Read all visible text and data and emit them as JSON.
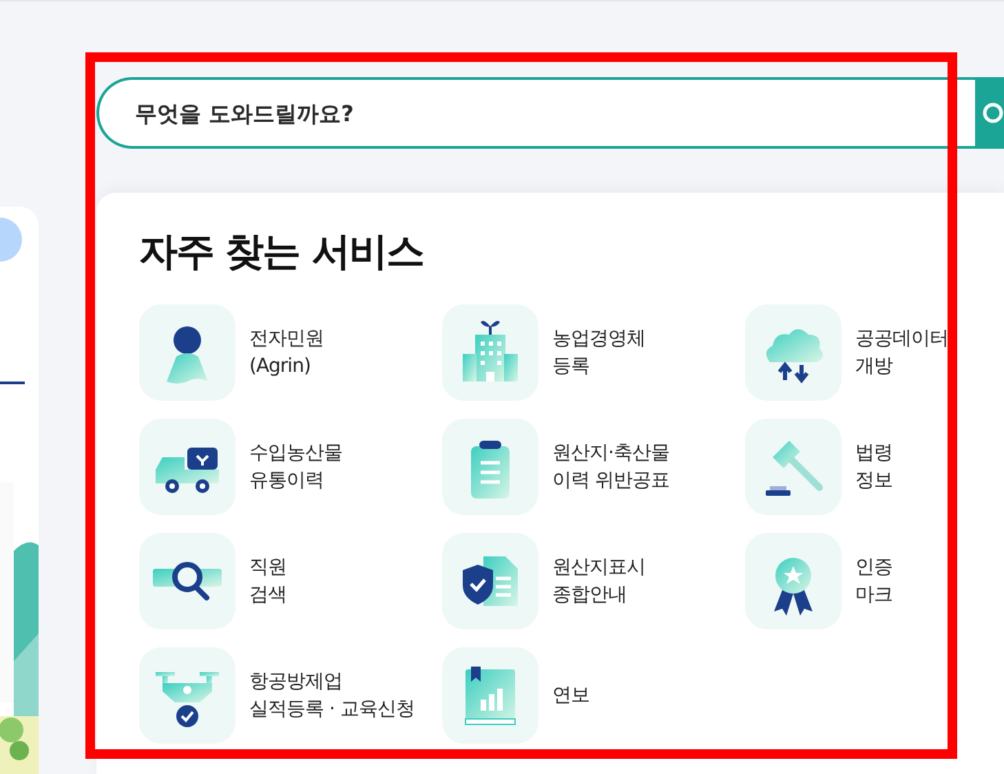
{
  "search": {
    "placeholder": "무엇을 도와드릴까요?"
  },
  "services_panel": {
    "title": "자주 찾는 서비스",
    "items": [
      {
        "label": "전자민원\n(Agrin)"
      },
      {
        "label": "농업경영체\n등록"
      },
      {
        "label": "공공데이터\n개방"
      },
      {
        "label": "수입농산물\n유통이력"
      },
      {
        "label": "원산지·축산물\n이력 위반공표"
      },
      {
        "label": "법령\n정보"
      },
      {
        "label": "직원\n검색"
      },
      {
        "label": "원산지표시\n종합안내"
      },
      {
        "label": "인증\n마크"
      },
      {
        "label": "항공방제업\n실적등록 · 교육신청"
      },
      {
        "label": "연보"
      }
    ]
  }
}
